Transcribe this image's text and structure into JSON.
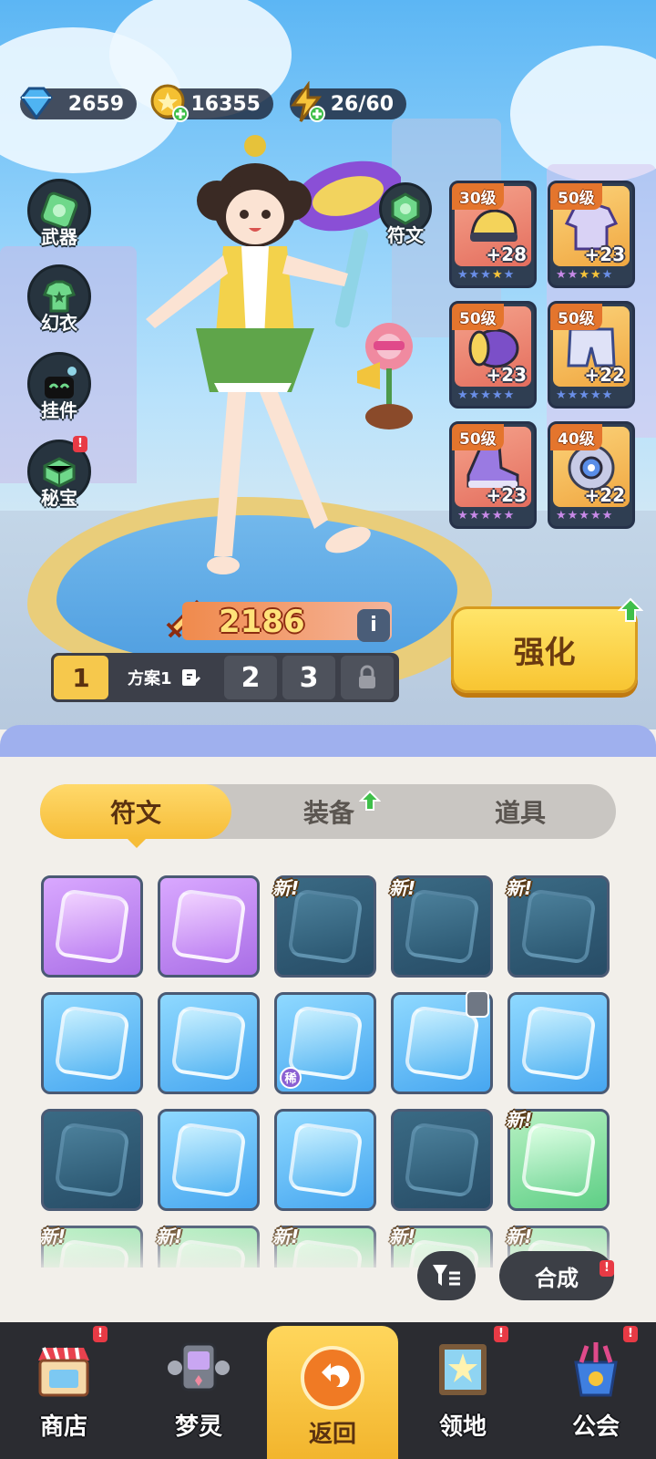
{
  "currencies": {
    "diamonds": "2659",
    "gold": "16355",
    "energy": "26/60"
  },
  "side_buttons": [
    {
      "label": "武器",
      "icon": "weapon-icon",
      "badge": false
    },
    {
      "label": "幻衣",
      "icon": "costume-icon",
      "badge": false
    },
    {
      "label": "挂件",
      "icon": "pendant-icon",
      "badge": false
    },
    {
      "label": "秘宝",
      "icon": "treasure-icon",
      "badge": true
    }
  ],
  "rune_button": {
    "label": "符文",
    "icon": "rune-icon"
  },
  "equipment": [
    {
      "level": "30级",
      "plus": "+28",
      "item": "helmet-icon",
      "frame": "red",
      "stars": 5
    },
    {
      "level": "50级",
      "plus": "+23",
      "item": "jacket-icon",
      "frame": "gold",
      "stars": 5
    },
    {
      "level": "50级",
      "plus": "+23",
      "item": "bracer-icon",
      "frame": "red",
      "stars": 5
    },
    {
      "level": "50级",
      "plus": "+22",
      "item": "pants-icon",
      "frame": "gold",
      "stars": 5
    },
    {
      "level": "50级",
      "plus": "+23",
      "item": "shoe-icon",
      "frame": "red",
      "stars": 5
    },
    {
      "level": "40级",
      "plus": "+22",
      "item": "gear-ring-icon",
      "frame": "gold",
      "stars": 5
    }
  ],
  "power": {
    "value": "2186",
    "info": "i"
  },
  "plans": {
    "slot1": "1",
    "name": "方案1",
    "slot2": "2",
    "slot3": "3"
  },
  "enhance_button": "强化",
  "tabs": [
    {
      "label": "符文",
      "active": true
    },
    {
      "label": "装备",
      "active": false,
      "arrow": true
    },
    {
      "label": "道具",
      "active": false
    }
  ],
  "runes": [
    {
      "style": "purple",
      "icon": "jacket-icon",
      "new": false
    },
    {
      "style": "purple",
      "icon": "shoe-icon",
      "new": false
    },
    {
      "style": "dark",
      "icon": "helmet-icon",
      "new": true
    },
    {
      "style": "dark",
      "icon": "bracer-icon",
      "new": true
    },
    {
      "style": "dark",
      "icon": "bracer-icon",
      "new": true
    },
    {
      "style": "blue",
      "icon": "jacket-icon",
      "new": false
    },
    {
      "style": "blue",
      "icon": "jacket-icon",
      "new": false
    },
    {
      "style": "blue",
      "icon": "jacket-icon",
      "new": false,
      "rare": "稀"
    },
    {
      "style": "blue",
      "icon": "jacket-icon",
      "new": false,
      "locked": true
    },
    {
      "style": "blue",
      "icon": "bracer-icon",
      "new": false
    },
    {
      "style": "dark",
      "icon": "pants-icon",
      "new": false
    },
    {
      "style": "blue",
      "icon": "glove-icon",
      "new": false
    },
    {
      "style": "blue",
      "icon": "glove-icon",
      "new": false
    },
    {
      "style": "dark",
      "icon": "glove-icon",
      "new": false
    },
    {
      "style": "green",
      "icon": "helmet-icon",
      "new": true
    },
    {
      "style": "greenfade",
      "icon": "rune-icon",
      "new": true
    },
    {
      "style": "greenfade",
      "icon": "rune-icon",
      "new": true
    },
    {
      "style": "greenfade",
      "icon": "rune-icon",
      "new": true
    },
    {
      "style": "greenfade",
      "icon": "rune-icon",
      "new": true
    },
    {
      "style": "greenfade",
      "icon": "rune-icon",
      "new": true
    }
  ],
  "new_tag": "新!",
  "merge_button": "合成",
  "nav": [
    {
      "label": "商店",
      "icon": "shop-icon",
      "badge": true
    },
    {
      "label": "梦灵",
      "icon": "robot-icon",
      "badge": false
    },
    {
      "label": "返回",
      "icon": "return-icon",
      "badge": false
    },
    {
      "label": "领地",
      "icon": "territory-icon",
      "badge": true
    },
    {
      "label": "公会",
      "icon": "guild-icon",
      "badge": true
    }
  ],
  "badge_text": "!",
  "colors": {
    "accent_yellow": "#f6bd38",
    "dark_panel": "#3c3f46",
    "badge_red": "#e83a45",
    "star_blue": "#6a8fe8"
  }
}
